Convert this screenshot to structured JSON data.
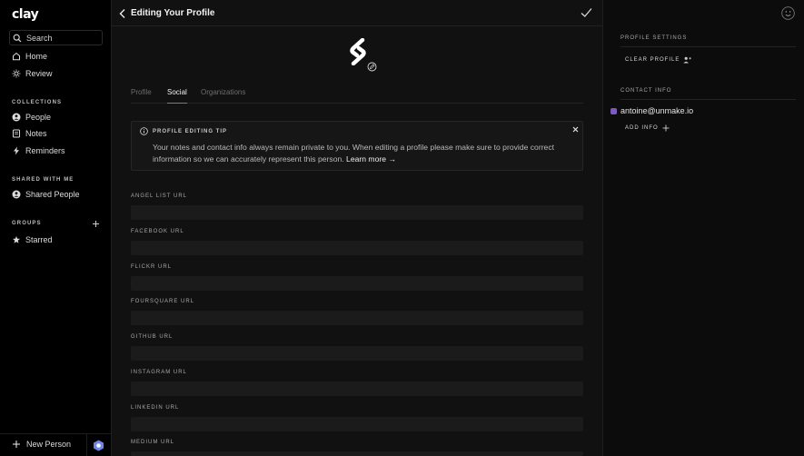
{
  "sidebar": {
    "logo": "clay",
    "search_label": "Search",
    "nav": [
      {
        "label": "Home",
        "icon": "home-icon"
      },
      {
        "label": "Review",
        "icon": "sun-icon"
      }
    ],
    "collections_header": "COLLECTIONS",
    "collections": [
      {
        "label": "People",
        "icon": "person-circle-icon"
      },
      {
        "label": "Notes",
        "icon": "notes-icon"
      },
      {
        "label": "Reminders",
        "icon": "bolt-icon"
      }
    ],
    "shared_header": "SHARED WITH ME",
    "shared": [
      {
        "label": "Shared People",
        "icon": "shared-people-icon"
      }
    ],
    "groups_header": "GROUPS",
    "groups": [
      {
        "label": "Starred",
        "icon": "star-icon"
      }
    ],
    "new_person_label": "New Person"
  },
  "main": {
    "title": "Editing Your Profile",
    "tabs": [
      {
        "label": "Profile",
        "active": false
      },
      {
        "label": "Social",
        "active": true
      },
      {
        "label": "Organizations",
        "active": false
      }
    ],
    "tip": {
      "heading": "PROFILE EDITING TIP",
      "body": "Your notes and contact info always remain private to you. When editing a profile please make sure to provide correct information so we can accurately represent this person.",
      "link": "Learn more →"
    },
    "fields": [
      {
        "label": "ANGEL LIST URL",
        "value": ""
      },
      {
        "label": "FACEBOOK URL",
        "value": ""
      },
      {
        "label": "FLICKR URL",
        "value": ""
      },
      {
        "label": "FOURSQUARE URL",
        "value": ""
      },
      {
        "label": "GITHUB URL",
        "value": ""
      },
      {
        "label": "INSTAGRAM URL",
        "value": ""
      },
      {
        "label": "LINKEDIN URL",
        "value": ""
      },
      {
        "label": "MEDIUM URL",
        "value": ""
      }
    ]
  },
  "right": {
    "profile_settings_header": "PROFILE SETTINGS",
    "clear_profile_label": "CLEAR PROFILE",
    "contact_info_header": "CONTACT INFO",
    "email": "antoine@unmake.io",
    "add_info_label": "ADD INFO"
  },
  "colors": {
    "accent": "#5d7bd6",
    "email_badge": "#7c5bbf",
    "background": "#111111"
  }
}
